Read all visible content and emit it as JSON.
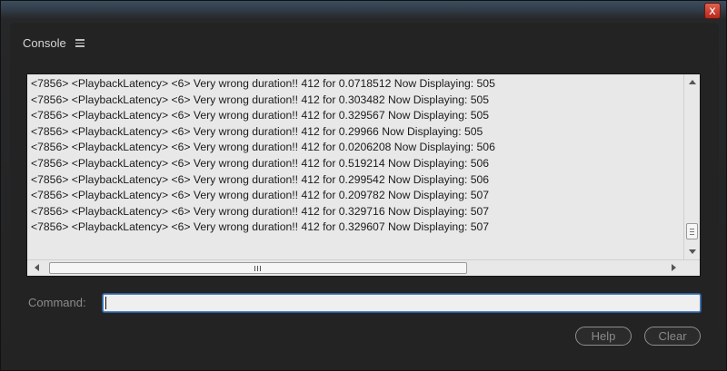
{
  "window": {
    "close_glyph": "x"
  },
  "panel": {
    "title": "Console",
    "menu_icon": "hamburger-menu-icon"
  },
  "console": {
    "lines": [
      "<7856> <PlaybackLatency> <6> Very wrong duration!! 412 for 0.0718512 Now Displaying: 505",
      "<7856> <PlaybackLatency> <6> Very wrong duration!! 412 for 0.303482 Now Displaying: 505",
      "<7856> <PlaybackLatency> <6> Very wrong duration!! 412 for 0.329567 Now Displaying: 505",
      "<7856> <PlaybackLatency> <6> Very wrong duration!! 412 for 0.29966 Now Displaying: 505",
      "<7856> <PlaybackLatency> <6> Very wrong duration!! 412 for 0.0206208 Now Displaying: 506",
      "<7856> <PlaybackLatency> <6> Very wrong duration!! 412 for 0.519214 Now Displaying: 506",
      "<7856> <PlaybackLatency> <6> Very wrong duration!! 412 for 0.299542 Now Displaying: 506",
      "<7856> <PlaybackLatency> <6> Very wrong duration!! 412 for 0.209782 Now Displaying: 507",
      "<7856> <PlaybackLatency> <6> Very wrong duration!! 412 for 0.329716 Now Displaying: 507",
      "<7856> <PlaybackLatency> <6> Very wrong duration!! 412 for 0.329607 Now Displaying: 507"
    ]
  },
  "command": {
    "label": "Command:",
    "value": ""
  },
  "buttons": {
    "help": "Help",
    "clear": "Clear"
  },
  "colors": {
    "panel_bg": "#232323",
    "console_bg": "#e8e8e8",
    "input_focus": "#4c7fbf",
    "close_button": "#c8392b"
  }
}
